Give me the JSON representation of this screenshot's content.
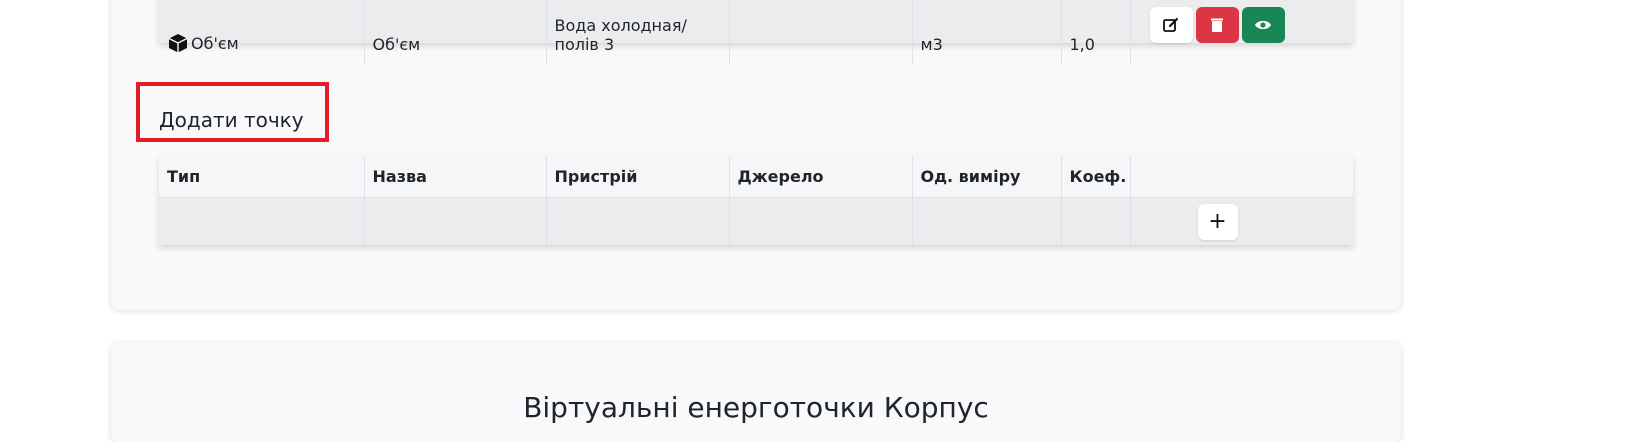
{
  "top_table": {
    "row": {
      "type": "Об'єм",
      "name": "Об'єм",
      "device": "Вода холодная/ полів 3",
      "source": "",
      "unit": "м3",
      "coef": "1,0"
    },
    "actions": [
      "edit-icon",
      "trash-icon",
      "eye-icon"
    ]
  },
  "add_point": {
    "label": "Додати точку",
    "columns": [
      "Тип",
      "Назва",
      "Пристрій",
      "Джерело",
      "Од. виміру",
      "Коеф.",
      ""
    ],
    "add_button_label": "+"
  },
  "bottom_card": {
    "title": "Віртуальні енерготочки Корпус"
  },
  "colors": {
    "highlight": "#e31c25",
    "danger": "#dc3545",
    "success": "#198754",
    "card_bg": "#f8f9fa",
    "row_bg": "#ebecee"
  }
}
